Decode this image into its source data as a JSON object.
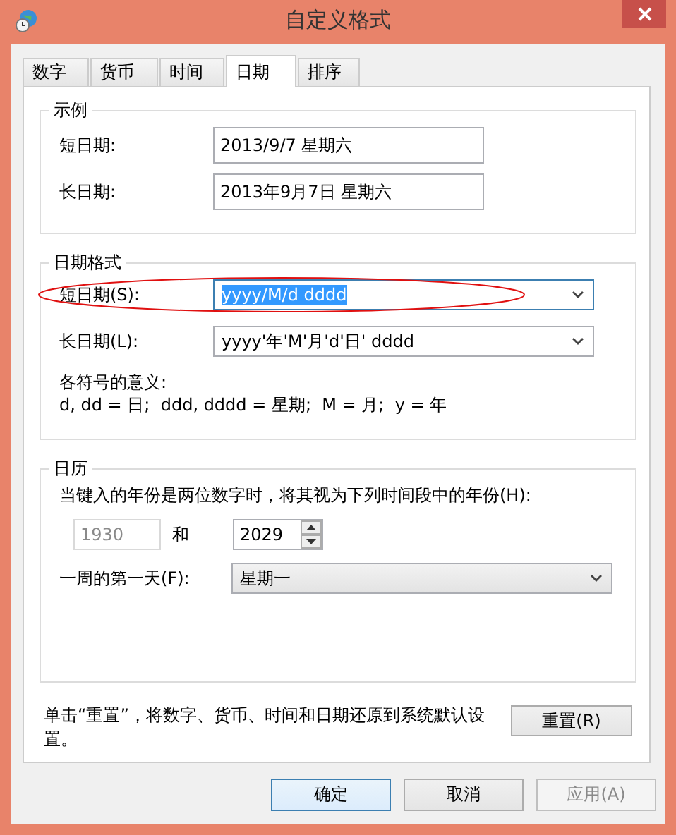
{
  "window": {
    "title": "自定义格式"
  },
  "tabs": [
    {
      "label": "数字",
      "selected": false
    },
    {
      "label": "货币",
      "selected": false
    },
    {
      "label": "时间",
      "selected": false
    },
    {
      "label": "日期",
      "selected": true
    },
    {
      "label": "排序",
      "selected": false
    }
  ],
  "sample": {
    "title": "示例",
    "rows": [
      {
        "label": "短日期:",
        "value": "2013/9/7 星期六"
      },
      {
        "label": "长日期:",
        "value": "2013年9月7日 星期六"
      }
    ]
  },
  "date_formats": {
    "title": "日期格式",
    "rows": [
      {
        "label": "短日期(S):",
        "value": "yyyy/M/d dddd",
        "focused": true,
        "circled": true
      },
      {
        "label": "长日期(L):",
        "value": "yyyy'年'M'月'd'日' dddd",
        "focused": false,
        "circled": false
      }
    ],
    "legend_title": "各符号的意义:",
    "legend": "d, dd = 日;  ddd, dddd = 星期;  M = 月;  y = 年"
  },
  "calendar": {
    "title": "日历",
    "two_digit_label": "当键入的年份是两位数字时，将其视为下列时间段中的年份(H):",
    "start_year": {
      "value": "1930",
      "disabled": true
    },
    "and": "和",
    "end_year": "2029",
    "first_day_label": "一周的第一天(F):",
    "first_day": "星期一"
  },
  "reset": {
    "note": "单击“重置”，将数字、货币、时间和日期还原到系统默认设置。",
    "button": "重置(R)"
  },
  "buttons": [
    {
      "label": "确定",
      "default": true,
      "disabled": false
    },
    {
      "label": "取消",
      "default": false,
      "disabled": false
    },
    {
      "label": "应用(A)",
      "default": false,
      "disabled": true
    }
  ]
}
